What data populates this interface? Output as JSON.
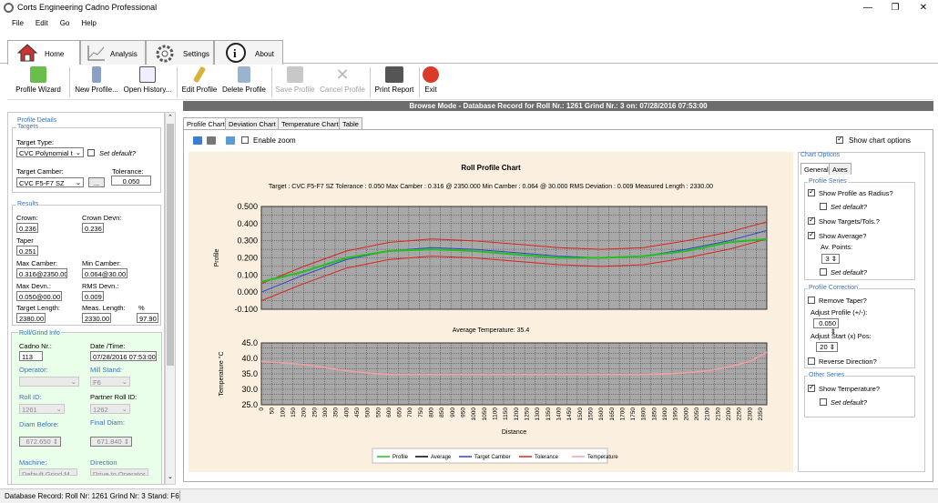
{
  "window": {
    "title": "Corts Engineering Cadno Professional",
    "minimize": "—",
    "restore": "❐",
    "close": "✕"
  },
  "menu": [
    "File",
    "Edit",
    "Go",
    "Help"
  ],
  "ribbon_tabs": [
    "Home",
    "Analysis",
    "Settings",
    "About"
  ],
  "toolbar": {
    "profile_wizard": "Profile Wizard",
    "new_profile": "New Profile...",
    "open_history": "Open History...",
    "edit_profile": "Edit Profile",
    "delete_profile": "Delete Profile",
    "save_profile": "Save Profile",
    "cancel_profile": "Cancel Profile",
    "print_report": "Print Report",
    "exit": "Exit"
  },
  "banner": "Browse Mode - Database Record for Roll Nr.: 1261 Grind Nr.: 3 on: 07/28/2016 07:53:00",
  "left": {
    "profile_details": "Profile Details",
    "targets": "Targets",
    "target_type_label": "Target Type:",
    "target_type_value": "CVC Polynomial t",
    "set_default": "Set default?",
    "target_camber_label": "Target Camber:",
    "target_camber_value": "CVC F5-F7 SZ",
    "browse": "...",
    "tolerance_label": "Tolerance:",
    "tolerance_value": "0.050",
    "results": "Results",
    "crown_label": "Crown:",
    "crown_value": "0.236",
    "crown_devn_label": "Crown Devn:",
    "crown_devn_value": "0.236",
    "taper_label": "Taper",
    "taper_value": "0.251",
    "max_camber_label": "Max Camber:",
    "max_camber_value": "0.316@2350.00",
    "min_camber_label": "Min Camber:",
    "min_camber_value": "0.064@30.00",
    "max_devn_label": "Max Devn.:",
    "max_devn_value": "0.050@00.00",
    "rms_devn_label": "RMS  Devn.:",
    "rms_devn_value": "0.009",
    "target_length_label": "Target Length:",
    "target_length_value": "2380.00",
    "meas_length_label": "Meas. Length:",
    "meas_length_value": "2330.00",
    "pct_label": "%",
    "pct_value": "97.90",
    "roll_grind_info": "Roll/Grind Info",
    "cadno_label": "Cadno Nr.:",
    "cadno_value": "113",
    "date_label": "Date /Time:",
    "date_value": "07/28/2016 07:53:00",
    "operator_label": "Operator:",
    "mill_stand_label": "Mill Stand:",
    "mill_stand_value": "F6",
    "roll_id_label": "Roll ID:",
    "roll_id_value": "1261",
    "partner_roll_label": "Partner Roll ID:",
    "partner_roll_value": "1262",
    "diam_before_label": "Diam Before:",
    "diam_before_value": "672.650",
    "final_diam_label": "Final Diam:",
    "final_diam_value": "671.840",
    "machine_label": "Machine:",
    "machine_value": "Default Grind M...",
    "direction_label": "Direction",
    "direction_value": "Drive to Operator"
  },
  "chart_tabs": [
    "Profile Chart",
    "Deviation Chart",
    "Temperature Chart",
    "Table"
  ],
  "enable_zoom": "Enable zoom",
  "show_chart_options": "Show chart options",
  "options": {
    "chart_options": "Chart Options",
    "tab_general": "General",
    "tab_axes": "Axes",
    "profile_series": "Profile Series",
    "show_profile_radius": "Show Profile as Radius?",
    "set_default": "Set default?",
    "show_targets": "Show Targets/Tols.?",
    "show_average": "Show Average?",
    "av_points": "Av. Points:",
    "av_points_value": "3",
    "profile_correction": "Profile Correction",
    "remove_taper": "Remove Taper?",
    "adjust_profile": "Adjust Profile (+/-):",
    "adjust_profile_value": "0.050",
    "adjust_start": "Adjust Start (x) Pos:",
    "adjust_start_value": "20",
    "reverse_direction": "Reverse Direction?",
    "other_series": "Other Series",
    "show_temperature": "Show Temperature?"
  },
  "status": "Database Record: Roll Nr: 1261 Grind Nr: 3  Stand: F6",
  "chart_data": [
    {
      "type": "line",
      "title": "Roll Profile Chart",
      "subtitle": "Target : CVC F5-F7 SZ    Tolerance : 0.050    Max Camber : 0.316 @ 2350.000    Min Camber : 0.064 @ 30.000    RMS Deviation : 0.009    Measured Length : 2330.00",
      "ylabel": "Profile",
      "xlabel": "",
      "ylim": [
        -0.1,
        0.5
      ],
      "yticks": [
        "0.500",
        "0.400",
        "0.300",
        "0.200",
        "0.100",
        "0.000",
        "-0.100"
      ],
      "x": [
        0,
        200,
        400,
        600,
        800,
        1000,
        1200,
        1400,
        1600,
        1800,
        2000,
        2200,
        2380
      ],
      "series": [
        {
          "name": "Profile",
          "color": "#22c022",
          "values": [
            0.06,
            0.12,
            0.2,
            0.24,
            0.25,
            0.24,
            0.22,
            0.2,
            0.2,
            0.21,
            0.24,
            0.29,
            0.31
          ]
        },
        {
          "name": "Average",
          "color": "#000000",
          "values": [
            0.06,
            0.12,
            0.2,
            0.24,
            0.25,
            0.24,
            0.22,
            0.2,
            0.2,
            0.21,
            0.24,
            0.29,
            0.31
          ]
        },
        {
          "name": "Target Camber",
          "color": "#3344cc",
          "values": [
            0.0,
            0.1,
            0.19,
            0.24,
            0.26,
            0.25,
            0.23,
            0.21,
            0.2,
            0.21,
            0.25,
            0.3,
            0.36
          ]
        },
        {
          "name": "Tolerance",
          "color": "#dd2222",
          "values": [
            0.05,
            0.15,
            0.24,
            0.29,
            0.31,
            0.3,
            0.28,
            0.26,
            0.25,
            0.26,
            0.3,
            0.35,
            0.41
          ]
        },
        {
          "name": "Tolerance",
          "color": "#dd2222",
          "values": [
            -0.05,
            0.05,
            0.14,
            0.19,
            0.21,
            0.2,
            0.18,
            0.16,
            0.15,
            0.16,
            0.2,
            0.25,
            0.31
          ]
        }
      ]
    },
    {
      "type": "line",
      "title": "Average Temperature: 35.4",
      "ylabel": "Temperature °C",
      "xlabel": "Distance",
      "ylim": [
        25,
        45
      ],
      "yticks": [
        "45.0",
        "40.0",
        "35.0",
        "30.0",
        "25.0"
      ],
      "xticks": [
        "0",
        "50",
        "100",
        "150",
        "200",
        "250",
        "300",
        "350",
        "400",
        "450",
        "500",
        "550",
        "600",
        "650",
        "700",
        "750",
        "800",
        "850",
        "900",
        "950",
        "1000",
        "1050",
        "1100",
        "1150",
        "1200",
        "1250",
        "1300",
        "1350",
        "1400",
        "1450",
        "1500",
        "1550",
        "1600",
        "1650",
        "1700",
        "1750",
        "1800",
        "1850",
        "1900",
        "1950",
        "2000",
        "2050",
        "2100",
        "2150",
        "2200",
        "2250",
        "2300",
        "2350"
      ],
      "x": [
        0,
        100,
        200,
        300,
        400,
        500,
        600,
        800,
        1000,
        1200,
        1400,
        1600,
        1800,
        1900,
        2000,
        2100,
        2200,
        2300,
        2380
      ],
      "series": [
        {
          "name": "Temperature",
          "color": "#f4a0a0",
          "values": [
            39,
            38.5,
            38,
            37,
            36,
            35.2,
            34.8,
            34.8,
            34.8,
            34.8,
            34.8,
            34.8,
            34.8,
            35,
            35.3,
            36,
            37.2,
            39,
            42
          ]
        }
      ]
    }
  ],
  "legend": [
    {
      "name": "Profile",
      "color": "#22c022"
    },
    {
      "name": "Average",
      "color": "#000000"
    },
    {
      "name": "Target Camber",
      "color": "#3344cc"
    },
    {
      "name": "Tolerance",
      "color": "#dd2222"
    },
    {
      "name": "Temperature",
      "color": "#f4a0a0"
    }
  ]
}
